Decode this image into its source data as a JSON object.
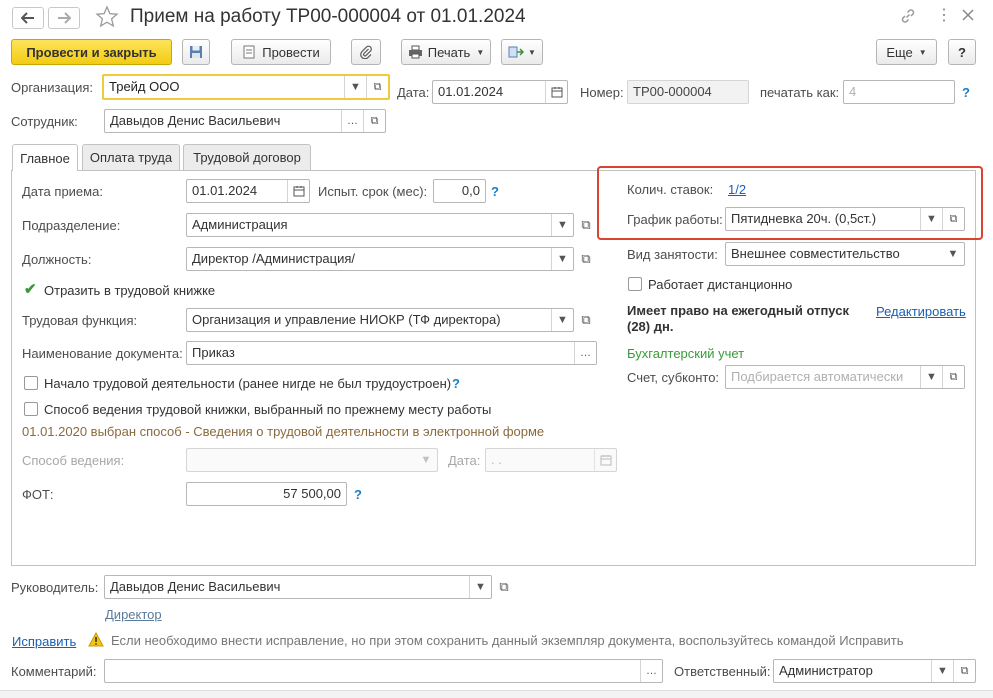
{
  "title": "Прием на работу ТР00-000004 от 01.01.2024",
  "toolbar": {
    "post_close": "Провести и закрыть",
    "post": "Провести",
    "print": "Печать",
    "more": "Еще",
    "help": "?"
  },
  "header": {
    "org_label": "Организация:",
    "org_value": "Трейд ООО",
    "date_label": "Дата:",
    "date_value": "01.01.2024",
    "number_label": "Номер:",
    "number_value": "ТР00-000004",
    "print_as_label": "печатать как:",
    "print_as_value": "4",
    "employee_label": "Сотрудник:",
    "employee_value": "Давыдов Денис Васильевич"
  },
  "tabs": [
    "Главное",
    "Оплата труда",
    "Трудовой договор"
  ],
  "main": {
    "hire_date_label": "Дата приема:",
    "hire_date_value": "01.01.2024",
    "probation_label": "Испыт. срок (мес):",
    "probation_value": "0,0",
    "department_label": "Подразделение:",
    "department_value": "Администрация",
    "position_label": "Должность:",
    "position_value": "Директор /Администрация/",
    "workbook_check": "Отразить в трудовой книжке",
    "labor_function_label": "Трудовая функция:",
    "labor_function_value": "Организация и управление НИОКР (ТФ директора)",
    "doc_name_label": "Наименование документа:",
    "doc_name_value": "Приказ",
    "career_start_check": "Начало трудовой деятельности (ранее нигде не был трудоустроен)",
    "book_method_check": "Способ ведения трудовой книжки, выбранный по прежнему месту работы",
    "method_info": "01.01.2020 выбран способ - Сведения о трудовой деятельности в электронной форме",
    "method_label": "Способ ведения:",
    "method_date_label": "Дата:",
    "method_date_value": " .  .",
    "fot_label": "ФОТ:",
    "fot_value": "57 500,00"
  },
  "right": {
    "rates_label": "Колич. ставок:",
    "rates_value": "1/2",
    "schedule_label": "График работы:",
    "schedule_value": "Пятидневка 20ч. (0,5ст.)",
    "employment_label": "Вид занятости:",
    "employment_value": "Внешнее совместительство",
    "remote_check": "Работает дистанционно",
    "vacation_text": "Имеет право на ежегодный отпуск (28) дн.",
    "edit_link": "Редактировать",
    "accounting_title": "Бухгалтерский учет",
    "account_label": "Счет, субконто:",
    "account_placeholder": "Подбирается автоматически"
  },
  "footer": {
    "manager_label": "Руководитель:",
    "manager_value": "Давыдов Денис Васильевич",
    "manager_position": "Директор",
    "fix_link": "Исправить",
    "warning": "Если необходимо внести исправление, но при этом сохранить данный экземпляр документа, воспользуйтесь командой Исправить",
    "comment_label": "Комментарий:",
    "responsible_label": "Ответственный:",
    "responsible_value": "Администратор"
  },
  "colors": {
    "primary_button": "#f8d51c",
    "highlight_box": "#d9432f",
    "link": "#1a5fb4",
    "accounting_title": "#3a9a3a",
    "focus_border": "#f0c93c"
  }
}
